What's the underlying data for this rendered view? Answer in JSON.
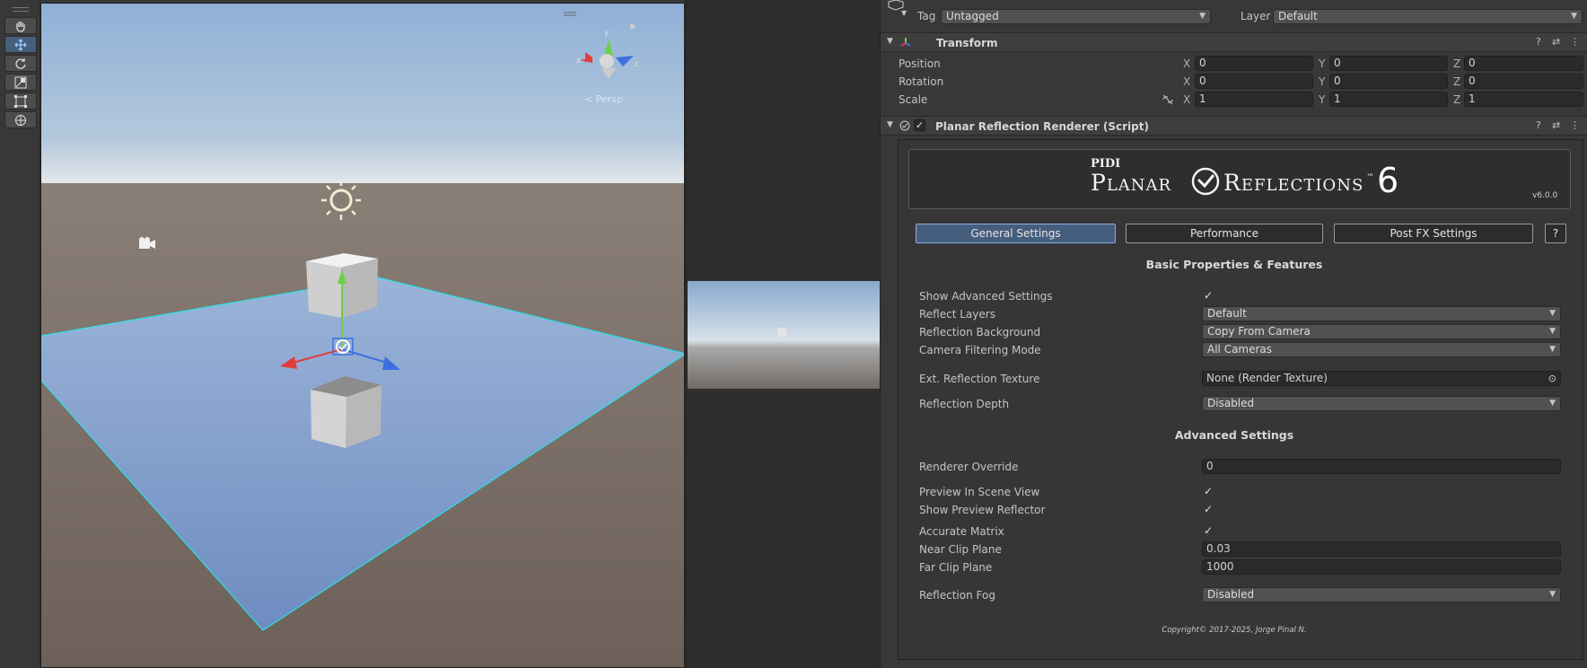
{
  "tools": [
    "hand-tool",
    "move-tool",
    "rotate-tool",
    "scale-tool",
    "rect-tool",
    "transform-tool"
  ],
  "scene": {
    "gizmo_y": "y",
    "gizmo_x": "x",
    "gizmo_z": "z",
    "persp_label": "Persp"
  },
  "header": {
    "tag_label": "Tag",
    "tag_value": "Untagged",
    "layer_label": "Layer",
    "layer_value": "Default"
  },
  "transform": {
    "title": "Transform",
    "position_label": "Position",
    "rotation_label": "Rotation",
    "scale_label": "Scale",
    "position": {
      "x": "0",
      "y": "0",
      "z": "0"
    },
    "rotation": {
      "x": "0",
      "y": "0",
      "z": "0"
    },
    "scale": {
      "x": "1",
      "y": "1",
      "z": "1"
    }
  },
  "component": {
    "title": "Planar Reflection Renderer (Script)"
  },
  "banner": {
    "brand": "PIDI",
    "title_left": "Planar",
    "title_right": "Reflections",
    "tm": "™",
    "number": "6",
    "version": "v6.0.0"
  },
  "tabs": [
    "General Settings",
    "Performance",
    "Post FX Settings",
    "?"
  ],
  "basic": {
    "title": "Basic Properties & Features",
    "show_advanced": "Show Advanced Settings",
    "reflect_layers": "Reflect Layers",
    "reflect_layers_value": "Default",
    "reflection_bg": "Reflection Background",
    "reflection_bg_value": "Copy From Camera",
    "camera_filter": "Camera Filtering Mode",
    "camera_filter_value": "All Cameras",
    "ext_texture": "Ext. Reflection Texture",
    "ext_texture_value": "None (Render Texture)",
    "depth": "Reflection Depth",
    "depth_value": "Disabled"
  },
  "advanced": {
    "title": "Advanced Settings",
    "renderer_override": "Renderer Override",
    "renderer_override_value": "0",
    "preview_scene": "Preview In Scene View",
    "show_preview": "Show Preview Reflector",
    "accurate": "Accurate Matrix",
    "near_clip": "Near Clip Plane",
    "near_clip_value": "0.03",
    "far_clip": "Far Clip Plane",
    "far_clip_value": "1000",
    "fog": "Reflection Fog",
    "fog_value": "Disabled"
  },
  "copyright": "Copyright© 2017-2025, Jorge Pinal N."
}
